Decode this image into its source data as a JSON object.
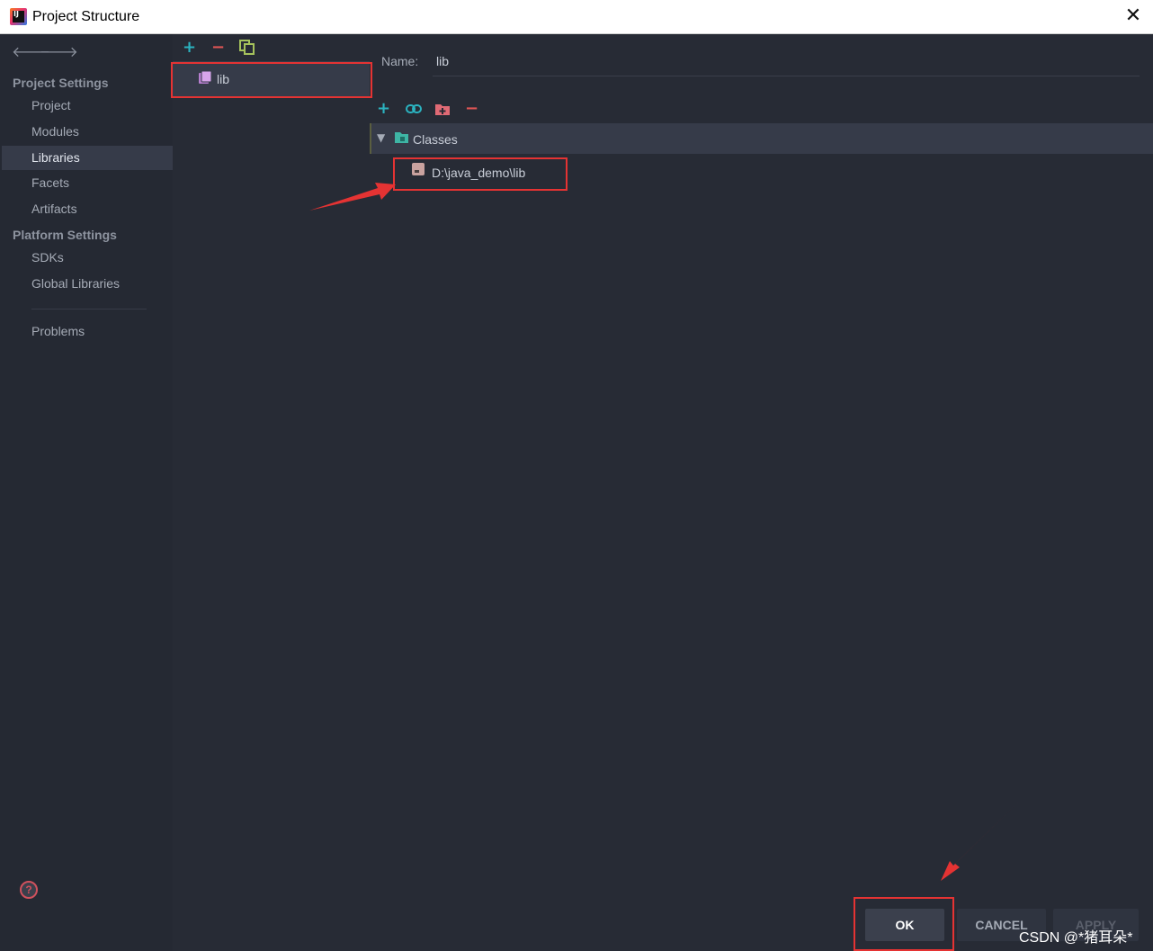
{
  "window": {
    "title": "Project Structure",
    "close_glyph": "✕",
    "app_icon_text": "IJ"
  },
  "nav": {
    "back": "🡐",
    "forward": "🡒"
  },
  "sidebar": {
    "project_settings_header": "Project Settings",
    "project_items": [
      {
        "label": "Project"
      },
      {
        "label": "Modules"
      },
      {
        "label": "Libraries"
      },
      {
        "label": "Facets"
      },
      {
        "label": "Artifacts"
      }
    ],
    "active_item": "Libraries",
    "platform_settings_header": "Platform Settings",
    "platform_items": [
      {
        "label": "SDKs"
      },
      {
        "label": "Global Libraries"
      }
    ],
    "problems_label": "Problems"
  },
  "library_list": {
    "toolbar": {
      "add": "+",
      "remove": "−"
    },
    "items": [
      {
        "label": "lib"
      }
    ]
  },
  "details": {
    "name_label": "Name:",
    "name_value": "lib",
    "toolbar": {
      "add": "+",
      "remove": "−"
    },
    "classes_label": "Classes",
    "class_path": "D:\\java_demo\\lib"
  },
  "buttons": {
    "ok": "OK",
    "cancel": "CANCEL",
    "apply": "APPLY"
  },
  "help": {
    "glyph": "?"
  },
  "watermark": "CSDN @*猪耳朵*",
  "colors": {
    "accent_add": "#2bb3c0",
    "accent_remove": "#e05555",
    "copy_icon": "#a5c25c",
    "annotation": "#e53333"
  }
}
